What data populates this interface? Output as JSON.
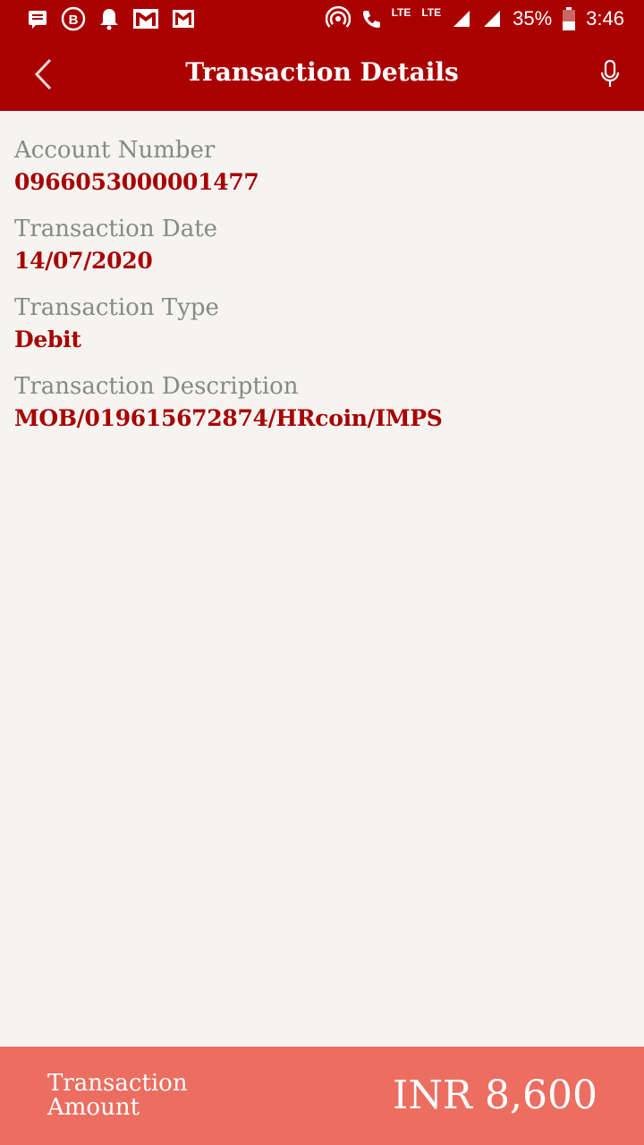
{
  "status_bar": {
    "lte_small": "LTE",
    "lte": "LTE",
    "battery": "35%",
    "time": "3:46",
    "icons": [
      "message-icon",
      "b-circle-icon",
      "bell-icon",
      "gmail-icon",
      "gmail-icon",
      "hotspot-icon",
      "volte-call-icon",
      "signal-icon",
      "signal-icon",
      "battery-icon"
    ]
  },
  "header": {
    "title": "Transaction Details",
    "back_icon": "chevron-left-icon",
    "mic_icon": "microphone-icon"
  },
  "details": [
    {
      "label": "Account Number",
      "value": "0966053000001477"
    },
    {
      "label": "Transaction Date",
      "value": "14/07/2020"
    },
    {
      "label": "Transaction Type",
      "value": "Debit"
    },
    {
      "label": "Transaction Description",
      "value": "MOB/019615672874/HRcoin/IMPS"
    }
  ],
  "footer": {
    "label_line1": "Transaction",
    "label_line2": "Amount",
    "amount": "INR 8,600"
  },
  "colors": {
    "primary": "#a90000",
    "value_text": "#a70000",
    "label_text": "#888888",
    "background": "#f5f4f1",
    "footer_bg": "#eb6e61"
  }
}
